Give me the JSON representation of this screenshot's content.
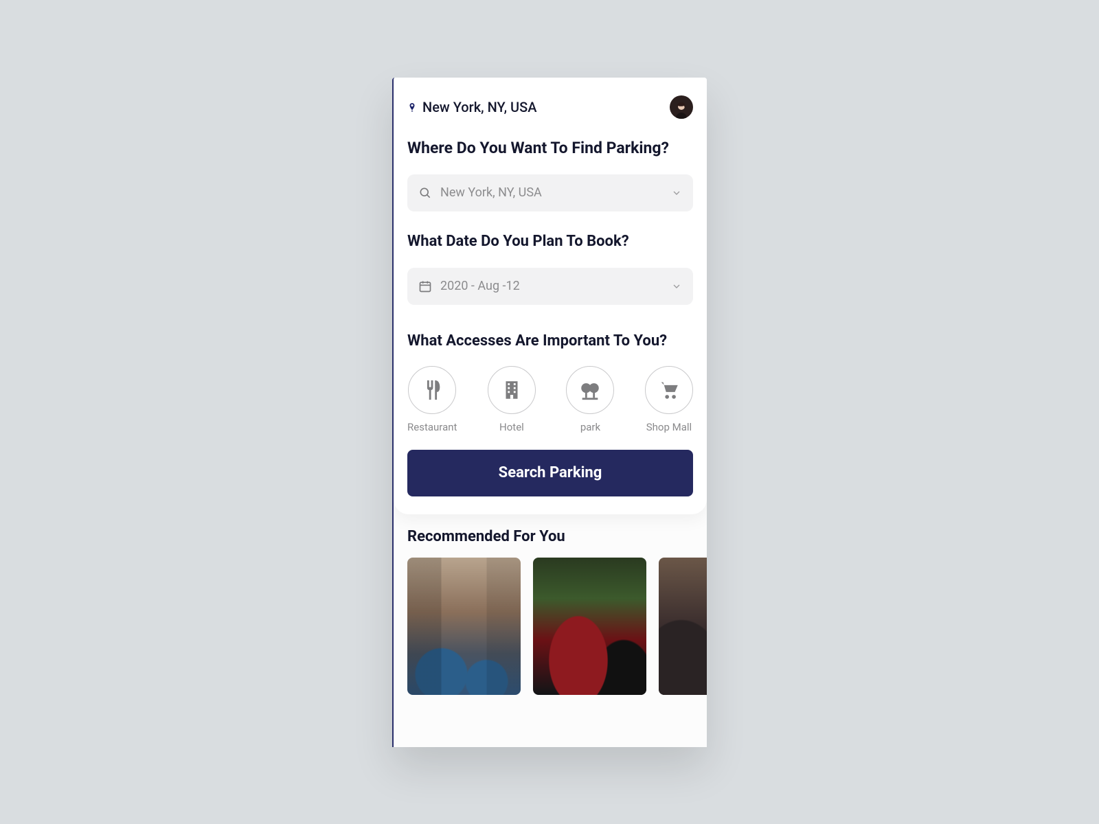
{
  "header": {
    "location": "New York, NY, USA"
  },
  "search": {
    "heading": "Where Do You Want To Find Parking?",
    "location_value": "New York, NY, USA"
  },
  "date": {
    "heading": "What Date Do You Plan To Book?",
    "value": "2020 - Aug -12"
  },
  "accesses": {
    "heading": "What Accesses Are Important To You?",
    "items": [
      {
        "label": "Restaurant"
      },
      {
        "label": "Hotel"
      },
      {
        "label": "park"
      },
      {
        "label": "Shop Mall"
      }
    ]
  },
  "cta": {
    "label": "Search Parking"
  },
  "recommended": {
    "heading": "Recommended For You"
  }
}
